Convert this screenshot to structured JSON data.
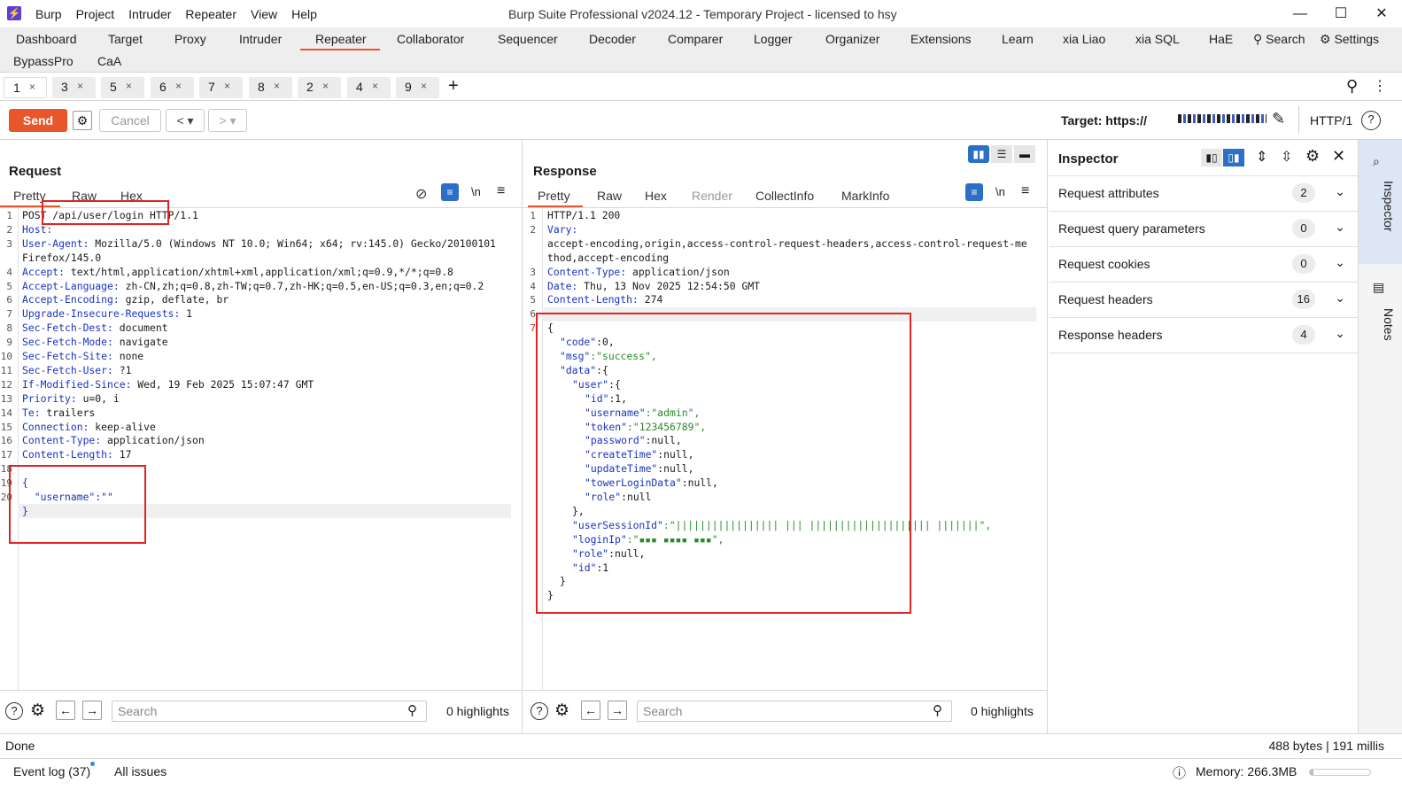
{
  "titlebar": {
    "menu": [
      "Burp",
      "Project",
      "Intruder",
      "Repeater",
      "View",
      "Help"
    ],
    "title": "Burp Suite Professional v2024.12 - Temporary Project - licensed to hsy"
  },
  "main_tabs": [
    "Dashboard",
    "Target",
    "Proxy",
    "Intruder",
    "Repeater",
    "Collaborator",
    "Sequencer",
    "Decoder",
    "Comparer",
    "Logger",
    "Organizer",
    "Extensions",
    "Learn",
    "xia Liao",
    "xia SQL",
    "HaE"
  ],
  "main_tabs_row2": [
    "BypassPro",
    "CaA"
  ],
  "top_right": {
    "search": "Search",
    "settings": "Settings"
  },
  "repeater_tabs": [
    {
      "num": "1",
      "x": "×"
    },
    {
      "num": "3",
      "x": "×"
    },
    {
      "num": "5",
      "x": "×"
    },
    {
      "num": "6",
      "x": "×"
    },
    {
      "num": "7",
      "x": "×"
    },
    {
      "num": "8",
      "x": "×"
    },
    {
      "num": "2",
      "x": "×"
    },
    {
      "num": "4",
      "x": "×"
    },
    {
      "num": "9",
      "x": "×"
    }
  ],
  "actions": {
    "send": "Send",
    "cancel": "Cancel",
    "target_label": "Target: https://",
    "protocol": "HTTP/1"
  },
  "request": {
    "title": "Request",
    "tabs": [
      "Pretty",
      "Raw",
      "Hex"
    ],
    "newline_label": "\\n",
    "lines": [
      {
        "n": "1",
        "name": "",
        "value": "POST /api/user/login HTTP/1.1"
      },
      {
        "n": "2",
        "name": "Host:",
        "value": " "
      },
      {
        "n": "3",
        "name": "User-Agent:",
        "value": " Mozilla/5.0 (Windows NT 10.0; Win64; x64; rv:145.0) Gecko/20100101"
      },
      {
        "n": "",
        "name": "",
        "value": "Firefox/145.0"
      },
      {
        "n": "4",
        "name": "Accept:",
        "value": " text/html,application/xhtml+xml,application/xml;q=0.9,*/*;q=0.8"
      },
      {
        "n": "5",
        "name": "Accept-Language:",
        "value": " zh-CN,zh;q=0.8,zh-TW;q=0.7,zh-HK;q=0.5,en-US;q=0.3,en;q=0.2"
      },
      {
        "n": "6",
        "name": "Accept-Encoding:",
        "value": " gzip, deflate, br"
      },
      {
        "n": "7",
        "name": "Upgrade-Insecure-Requests:",
        "value": " 1"
      },
      {
        "n": "8",
        "name": "Sec-Fetch-Dest:",
        "value": " document"
      },
      {
        "n": "9",
        "name": "Sec-Fetch-Mode:",
        "value": " navigate"
      },
      {
        "n": "10",
        "name": "Sec-Fetch-Site:",
        "value": " none"
      },
      {
        "n": "11",
        "name": "Sec-Fetch-User:",
        "value": " ?1"
      },
      {
        "n": "12",
        "name": "If-Modified-Since:",
        "value": " Wed, 19 Feb 2025 15:07:47 GMT"
      },
      {
        "n": "13",
        "name": "Priority:",
        "value": " u=0, i"
      },
      {
        "n": "14",
        "name": "Te:",
        "value": " trailers"
      },
      {
        "n": "15",
        "name": "Connection:",
        "value": " keep-alive"
      },
      {
        "n": "16",
        "name": "Content-Type:",
        "value": " application/json"
      },
      {
        "n": "17",
        "name": "Content-Length:",
        "value": " 17"
      },
      {
        "n": "18",
        "name": "",
        "value": ""
      },
      {
        "n": "19",
        "name": "",
        "value": "{"
      },
      {
        "n": "20",
        "name": "",
        "value": "  \"username\":\"\""
      },
      {
        "n": "",
        "name": "",
        "value": "}"
      }
    ],
    "search_placeholder": "Search",
    "highlights": "0 highlights"
  },
  "response": {
    "title": "Response",
    "tabs": [
      "Pretty",
      "Raw",
      "Hex",
      "Render",
      "CollectInfo",
      "MarkInfo"
    ],
    "newline_label": "\\n",
    "header_lines": [
      {
        "n": "1",
        "name": "",
        "value": "HTTP/1.1 200"
      },
      {
        "n": "2",
        "name": "Vary:",
        "value": ""
      },
      {
        "n": "",
        "name": "",
        "value": "accept-encoding,origin,access-control-request-headers,access-control-request-me"
      },
      {
        "n": "",
        "name": "",
        "value": "thod,accept-encoding"
      },
      {
        "n": "3",
        "name": "Content-Type:",
        "value": " application/json"
      },
      {
        "n": "4",
        "name": "Date:",
        "value": " Thu, 13 Nov 2025 12:54:50 GMT"
      },
      {
        "n": "5",
        "name": "Content-Length:",
        "value": " 274"
      },
      {
        "n": "6",
        "name": "",
        "value": ""
      }
    ],
    "body_lines": [
      {
        "k": "",
        "v": "{",
        "indent": 0
      },
      {
        "k": "\"code\"",
        "v": ":0,",
        "indent": 1,
        "vt": "plain"
      },
      {
        "k": "\"msg\"",
        "v": ":\"success\",",
        "indent": 1,
        "vt": "str"
      },
      {
        "k": "\"data\"",
        "v": ":{",
        "indent": 1,
        "vt": "plain"
      },
      {
        "k": "\"user\"",
        "v": ":{",
        "indent": 2,
        "vt": "plain"
      },
      {
        "k": "\"id\"",
        "v": ":1,",
        "indent": 3,
        "vt": "plain"
      },
      {
        "k": "\"username\"",
        "v": ":\"admin\",",
        "indent": 3,
        "vt": "str"
      },
      {
        "k": "\"token\"",
        "v": ":\"123456789\",",
        "indent": 3,
        "vt": "str"
      },
      {
        "k": "\"password\"",
        "v": ":null,",
        "indent": 3,
        "vt": "plain"
      },
      {
        "k": "\"createTime\"",
        "v": ":null,",
        "indent": 3,
        "vt": "plain"
      },
      {
        "k": "\"updateTime\"",
        "v": ":null,",
        "indent": 3,
        "vt": "plain"
      },
      {
        "k": "\"towerLoginData\"",
        "v": ":null,",
        "indent": 3,
        "vt": "plain"
      },
      {
        "k": "\"role\"",
        "v": ":null",
        "indent": 3,
        "vt": "plain"
      },
      {
        "k": "",
        "v": "},",
        "indent": 2
      },
      {
        "k": "\"userSessionId\"",
        "v": ":\"||||||||||||||||| ||| |||||||||||||||||||| |||||||\",",
        "indent": 2,
        "vt": "str"
      },
      {
        "k": "\"loginIp\"",
        "v": ":\"▪▪▪ ▪▪▪▪ ▪▪▪\",",
        "indent": 2,
        "vt": "str"
      },
      {
        "k": "\"role\"",
        "v": ":null,",
        "indent": 2,
        "vt": "plain"
      },
      {
        "k": "\"id\"",
        "v": ":1",
        "indent": 2,
        "vt": "plain"
      },
      {
        "k": "",
        "v": "}",
        "indent": 1
      },
      {
        "k": "",
        "v": "}",
        "indent": 0
      }
    ],
    "search_placeholder": "Search",
    "highlights": "0 highlights"
  },
  "inspector": {
    "title": "Inspector",
    "rows": [
      {
        "label": "Request attributes",
        "count": "2"
      },
      {
        "label": "Request query parameters",
        "count": "0"
      },
      {
        "label": "Request cookies",
        "count": "0"
      },
      {
        "label": "Request headers",
        "count": "16"
      },
      {
        "label": "Response headers",
        "count": "4"
      }
    ],
    "side_tabs": [
      "Inspector",
      "Notes"
    ]
  },
  "status": {
    "left": "Done",
    "right": "488 bytes | 191 millis"
  },
  "bottom": {
    "event_log": "Event log (37)",
    "all_issues": "All issues",
    "memory": "Memory: 266.3MB"
  },
  "colors": {
    "accent": "#e8562a",
    "header_name": "#1a33c0",
    "json_string": "#2b8a2b",
    "highlight_box": "#e02424"
  }
}
